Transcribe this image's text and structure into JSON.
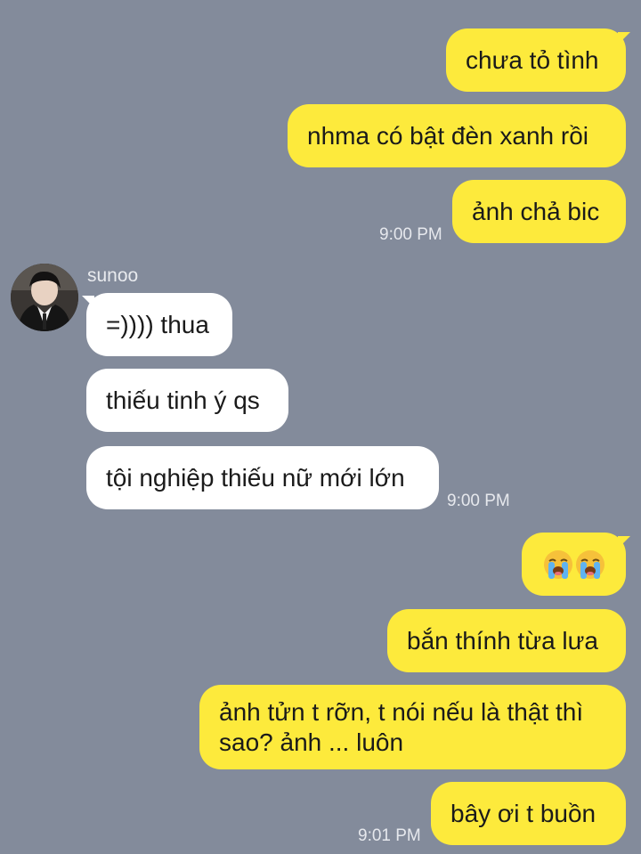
{
  "chat": {
    "contact_name": "sunoo",
    "messages": [
      {
        "text": "chưa tỏ tình"
      },
      {
        "text": "nhma có bật đèn xanh rồi"
      },
      {
        "text": "ảnh chả bic",
        "time": "9:00 PM"
      },
      {
        "text": "=)))) thua"
      },
      {
        "text": "thiếu tinh ý qs"
      },
      {
        "text": "tội nghiệp thiếu nữ mới lớn",
        "time": "9:00 PM"
      },
      {
        "text": "😭😭",
        "icon": "loudly-crying-face-icon"
      },
      {
        "text": "bắn thính từa lưa"
      },
      {
        "text": "ảnh tửn t rỡn, t nói nếu là thật thì sao? ảnh ... luôn"
      },
      {
        "text": "bây ơi t buồn",
        "time": "9:01 PM"
      }
    ]
  },
  "colors": {
    "background": "#838b9b",
    "outgoing_bubble": "#fdea3c",
    "incoming_bubble": "#ffffff"
  }
}
